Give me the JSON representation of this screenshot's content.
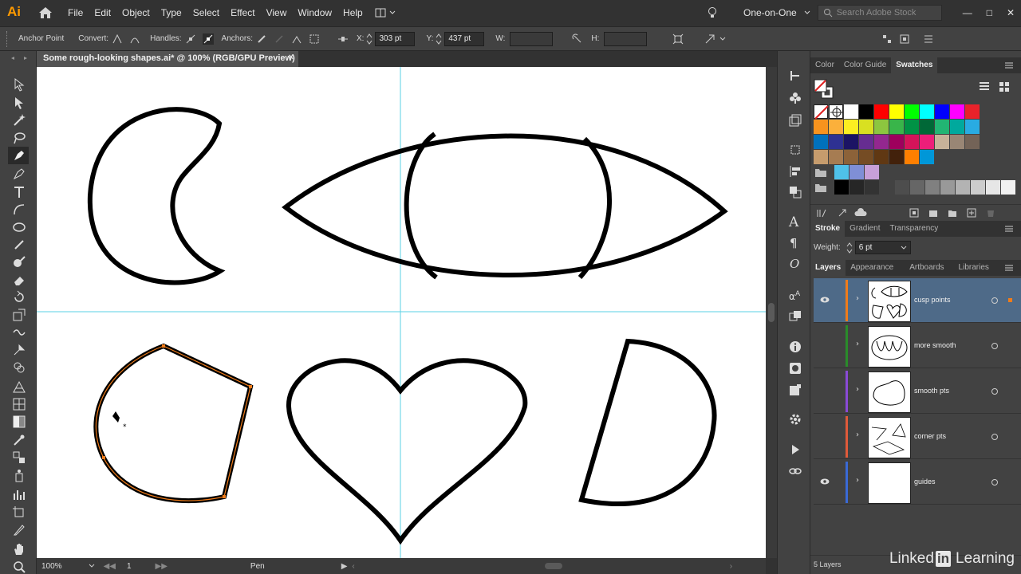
{
  "app": {
    "logo": "Ai"
  },
  "menu": [
    "File",
    "Edit",
    "Object",
    "Type",
    "Select",
    "Effect",
    "View",
    "Window",
    "Help"
  ],
  "workspace": {
    "name": "One-on-One",
    "search_placeholder": "Search Adobe Stock"
  },
  "control": {
    "tool_label": "Anchor Point",
    "convert_label": "Convert:",
    "handles_label": "Handles:",
    "anchors_label": "Anchors:",
    "x_label": "X:",
    "x_value": "303 pt",
    "y_label": "Y:",
    "y_value": "437 pt",
    "w_label": "W:",
    "h_label": "H:"
  },
  "document": {
    "tab_title": "Some rough-looking shapes.ai* @ 100% (RGB/GPU Preview)",
    "close": "×"
  },
  "status": {
    "zoom": "100%",
    "artboard": "1",
    "tool": "Pen"
  },
  "panels": {
    "color_tabs": [
      "Color",
      "Color Guide",
      "Swatches"
    ],
    "stroke_tabs": [
      "Stroke",
      "Gradient",
      "Transparency"
    ],
    "weight_label": "Weight:",
    "weight_value": "6 pt",
    "layers_tabs": [
      "Layers",
      "Appearance",
      "Artboards",
      "Libraries"
    ],
    "layers": [
      {
        "name": "cusp points",
        "color": "#f07c1a",
        "visible": true
      },
      {
        "name": "more smooth",
        "color": "#2a8c2a",
        "visible": false
      },
      {
        "name": "smooth pts",
        "color": "#8a4ad6",
        "visible": false
      },
      {
        "name": "corner pts",
        "color": "#e05a3a",
        "visible": false
      },
      {
        "name": "guides",
        "color": "#3a6ad6",
        "visible": true
      }
    ],
    "layers_count": "5 Layers"
  },
  "swatches": {
    "row1": [
      "#ffffff",
      "#000000",
      "#ff0000",
      "#ffff00",
      "#00ff00",
      "#00ffff",
      "#0000ff",
      "#ff00ff",
      "#e8222a"
    ],
    "row2": [
      "#f7931e",
      "#fbb03b",
      "#fcee21",
      "#d9e021",
      "#8cc63f",
      "#39b54a",
      "#009245",
      "#006837",
      "#22b573",
      "#00a99d",
      "#29abe2"
    ],
    "row3": [
      "#0071bc",
      "#2e3192",
      "#1b1464",
      "#662d91",
      "#93278f",
      "#9e005d",
      "#d4145a",
      "#ed1e79",
      "#c7b299",
      "#998675",
      "#736357"
    ],
    "row4": [
      "#c69c6d",
      "#a67c52",
      "#8c6239",
      "#754c24",
      "#603813",
      "#42210b",
      "#ff7f00",
      "#0097d8"
    ],
    "row5": [
      "#4fc1e9",
      "#7f8fd6",
      "#c7a0d8"
    ],
    "row6": [
      "#000000",
      "#262626",
      "#333333",
      "#4d4d4d",
      "#666666",
      "#808080",
      "#999999",
      "#b3b3b3",
      "#cccccc",
      "#e6e6e6",
      "#f2f2f2"
    ]
  },
  "watermark": {
    "a": "Linked",
    "b": "in",
    "c": "Learning"
  }
}
